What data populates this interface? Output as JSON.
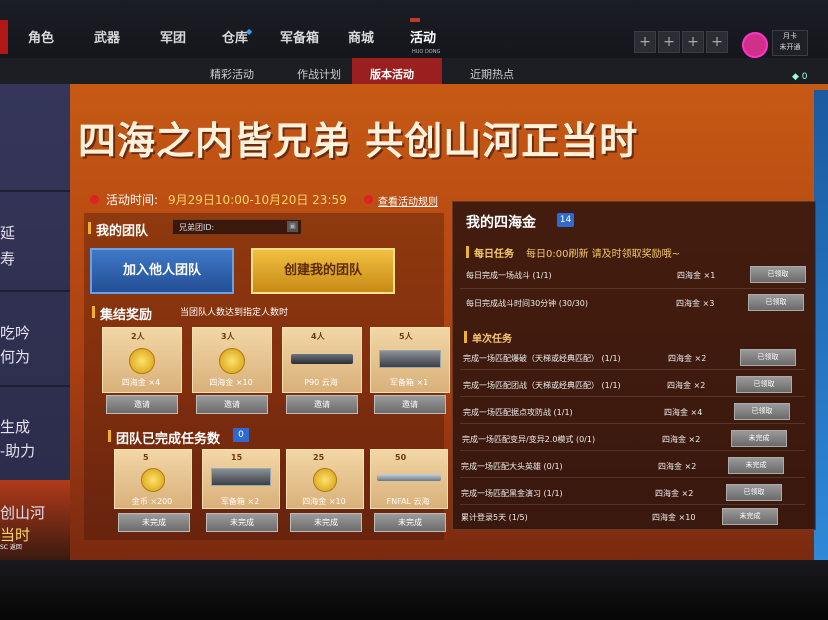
{
  "nav": {
    "items": [
      "角色",
      "武器",
      "军团",
      "仓库",
      "军备箱",
      "商城",
      "活动"
    ],
    "active_sub": "HUO DONG",
    "month_card_label": "月卡",
    "month_card_status": "未开通"
  },
  "subnav": {
    "tabs": [
      "精彩活动",
      "作战计划",
      "版本活动",
      "近期热点"
    ],
    "active_index": 2,
    "gem_count": "0"
  },
  "sidebar": {
    "lines": [
      "延",
      "寿",
      "吃吟",
      "何为",
      "生成",
      "-助力",
      "创山河",
      "当时"
    ],
    "labels": [
      "SC",
      "返回"
    ]
  },
  "banner": {
    "title": "四海之内皆兄弟 共创山河正当时",
    "time_label": "活动时间:",
    "time_value": "9月29日10:00-10月20日 23:59",
    "rules_link": "查看活动规则"
  },
  "team": {
    "title": "我的团队",
    "id_label": "兄弟团ID:",
    "join_button": "加入他人团队",
    "create_button": "创建我的团队"
  },
  "gather": {
    "title": "集结奖励",
    "rule": "当团队人数达到指定人数时",
    "cards": [
      {
        "count": "2",
        "unit": "人",
        "reward": "四海金 ×4",
        "button": "邀请"
      },
      {
        "count": "3",
        "unit": "人",
        "reward": "四海金 ×10",
        "button": "邀请"
      },
      {
        "count": "4",
        "unit": "人",
        "reward": "P90 云海",
        "button": "邀请"
      },
      {
        "count": "5",
        "unit": "人",
        "reward": "军备箱 ×1",
        "button": "邀请"
      }
    ]
  },
  "team_tasks": {
    "title": "团队已完成任务数",
    "count": "0",
    "cards": [
      {
        "count": "5",
        "reward": "金币 ×200",
        "button": "未完成"
      },
      {
        "count": "15",
        "reward": "军备箱 ×2",
        "button": "未完成"
      },
      {
        "count": "25",
        "reward": "四海金 ×10",
        "button": "未完成"
      },
      {
        "count": "50",
        "reward": "FNFAL 云海",
        "button": "未完成"
      }
    ]
  },
  "sihaijin": {
    "title": "我的四海金",
    "count": "14",
    "daily_title": "每日任务",
    "daily_note": "每日0:00刷新 请及时领取奖励哦~",
    "daily": [
      {
        "task": "每日完成一场战斗 (1/1)",
        "reward": "四海金 ×1",
        "button": "已领取"
      },
      {
        "task": "每日完成战斗时间30分钟 (30/30)",
        "reward": "四海金 ×3",
        "button": "已领取"
      }
    ],
    "single_title": "单次任务",
    "single": [
      {
        "task": "完成一场匹配爆破（天梯或经典匹配） (1/1)",
        "reward": "四海金 ×2",
        "button": "已领取"
      },
      {
        "task": "完成一场匹配团战（天梯或经典匹配） (1/1)",
        "reward": "四海金 ×2",
        "button": "已领取"
      },
      {
        "task": "完成一场匹配据点攻防战 (1/1)",
        "reward": "四海金 ×4",
        "button": "已领取"
      },
      {
        "task": "完成一场匹配变异/变异2.0模式 (0/1)",
        "reward": "四海金 ×2",
        "button": "未完成"
      },
      {
        "task": "完成一场匹配大头英雄 (0/1)",
        "reward": "四海金 ×2",
        "button": "未完成"
      },
      {
        "task": "完成一场匹配黑金演习 (1/1)",
        "reward": "四海金 ×2",
        "button": "已领取"
      },
      {
        "task": "累计登录5天 (1/5)",
        "reward": "四海金 ×10",
        "button": "未完成"
      }
    ]
  },
  "colors": {
    "accent_red": "#9b1f1f",
    "banner_orange": "#c65a14",
    "gold": "#f5c76a",
    "blue_badge": "#2d6bd1"
  }
}
